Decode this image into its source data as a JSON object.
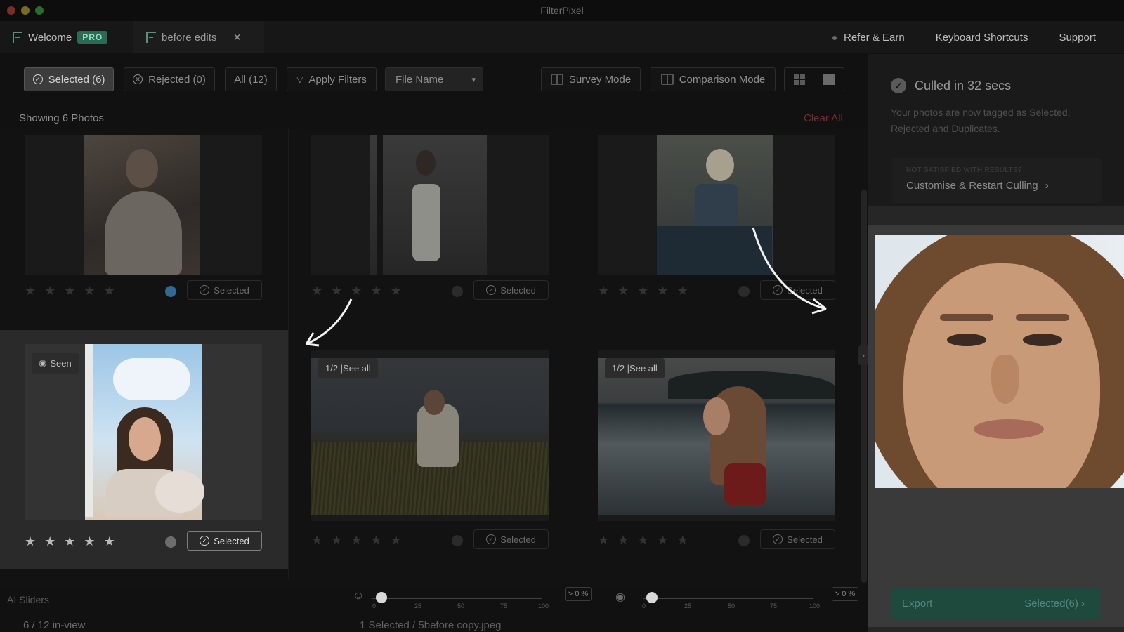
{
  "window": {
    "title": "FilterPixel"
  },
  "tabs": [
    {
      "label": "Welcome",
      "badge": "PRO"
    },
    {
      "label": "before edits",
      "close": "×"
    }
  ],
  "top_links": [
    "Refer & Earn",
    "Keyboard Shortcuts",
    "Support"
  ],
  "filters": {
    "selected": "Selected (6)",
    "rejected": "Rejected (0)",
    "all": "All (12)",
    "apply": "Apply Filters",
    "sort": "File Name",
    "survey": "Survey Mode",
    "comparison": "Comparison Mode"
  },
  "grid": {
    "showing": "Showing 6 Photos",
    "clear_all": "Clear All",
    "cells": [
      {
        "button": "Selected",
        "stars": "★",
        "overlay": ""
      },
      {
        "button": "Selected",
        "stars": "★",
        "overlay": ""
      },
      {
        "button": "Selected",
        "stars": "★",
        "overlay": ""
      },
      {
        "button": "Selected",
        "stars": "★",
        "overlay": "Seen"
      },
      {
        "button": "Selected",
        "stars": "★",
        "overlay": "1/2 |See all"
      },
      {
        "button": "Selected",
        "stars": "★",
        "overlay": "1/2 |See all"
      }
    ]
  },
  "right_panel": {
    "culled": "Culled in 32 secs",
    "description": "Your photos are now tagged as Selected, Rejected and Duplicates.",
    "not_satisfied": "NOT SATISFIED WITH RESULTS?",
    "restart": "Customise & Restart Culling",
    "export": "Export",
    "export_count": "Selected(6)"
  },
  "bottom": {
    "ai_sliders": "AI Sliders",
    "in_view": "6 / 12 in-view",
    "status": "1 Selected / 5before copy.jpeg",
    "slider_ticks": [
      "0",
      "25",
      "50",
      "75",
      "100"
    ],
    "slider1_pct": "> 0 %",
    "slider2_pct": "> 0 %"
  },
  "colors": {
    "accent_green": "#2c6a55",
    "clear_red": "#7a2d2d",
    "label_blue": "#2f6a93"
  }
}
